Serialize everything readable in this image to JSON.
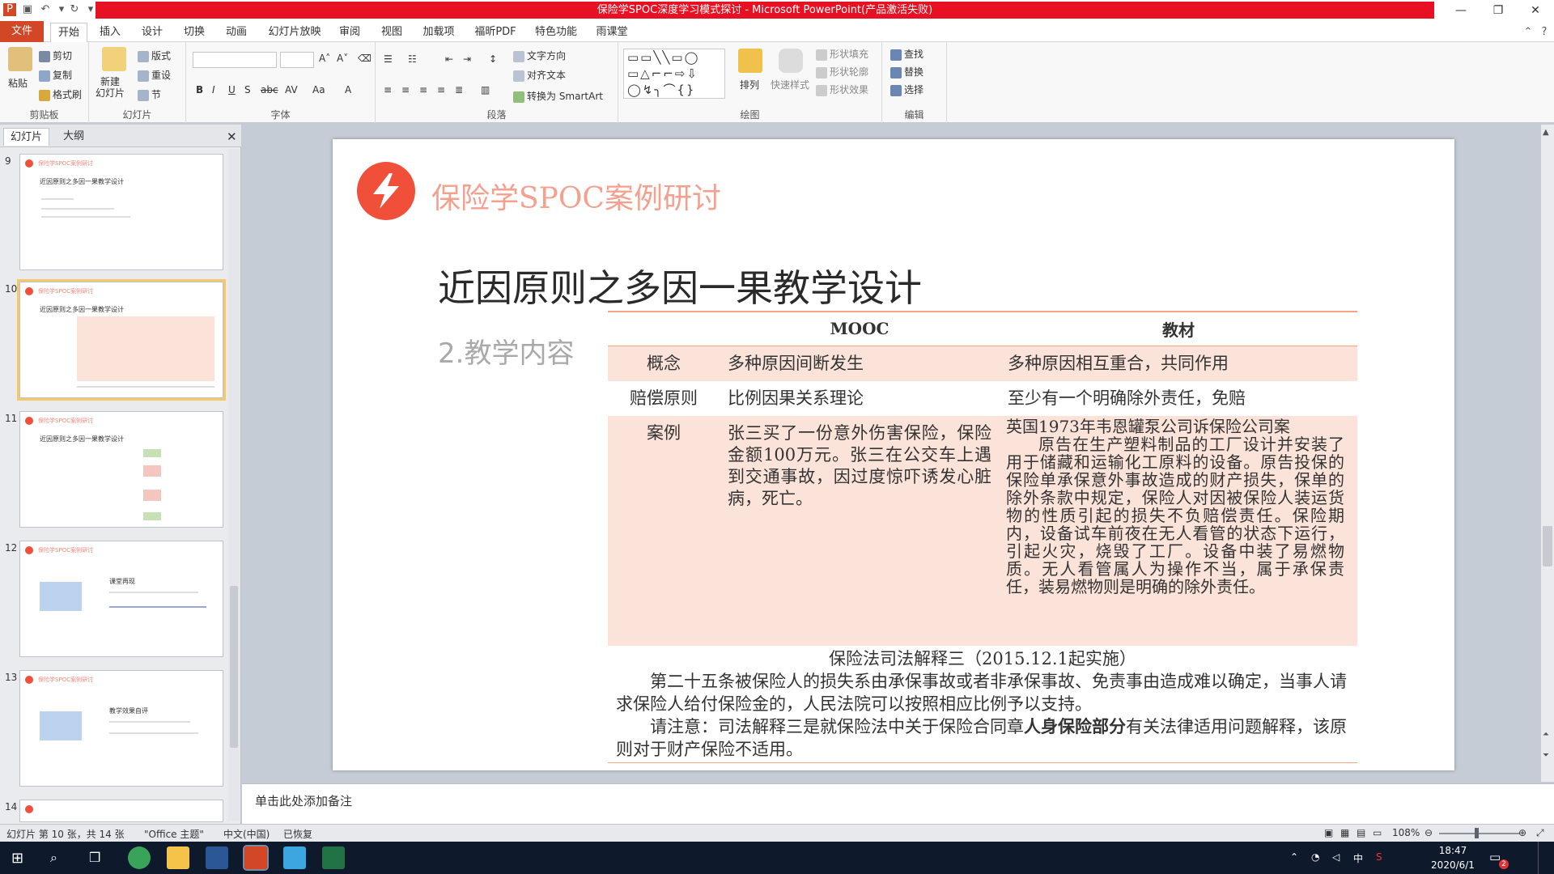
{
  "window": {
    "title": "保险学SPOC深度学习模式探讨 - Microsoft PowerPoint(产品激活失败)"
  },
  "ribbon": {
    "tabs": [
      "文件",
      "开始",
      "插入",
      "设计",
      "切换",
      "动画",
      "幻灯片放映",
      "审阅",
      "视图",
      "加载项",
      "福昕PDF",
      "特色功能",
      "雨课堂"
    ],
    "active_tab": "开始",
    "groups": {
      "clipboard": {
        "label": "剪贴板",
        "paste": "粘贴",
        "cut": "剪切",
        "copy": "复制",
        "format_painter": "格式刷"
      },
      "slides": {
        "label": "幻灯片",
        "new_slide": "新建\n幻灯片",
        "layout": "版式",
        "reset": "重设",
        "section": "节"
      },
      "font": {
        "label": "字体"
      },
      "paragraph": {
        "label": "段落",
        "text_direction": "文字方向",
        "align_text": "对齐文本",
        "convert_smartart": "转换为 SmartArt"
      },
      "drawing": {
        "label": "绘图",
        "arrange": "排列",
        "quick_styles": "快速样式",
        "shape_fill": "形状填充",
        "shape_outline": "形状轮廓",
        "shape_effects": "形状效果"
      },
      "editing": {
        "label": "编辑",
        "find": "查找",
        "replace": "替换",
        "select": "选择"
      }
    }
  },
  "left_panel": {
    "tabs": [
      "幻灯片",
      "大纲"
    ],
    "thumbnails": [
      {
        "num": "9",
        "brand": "保险学SPOC案例研讨",
        "title": "近因原则之多因一果教学设计"
      },
      {
        "num": "10",
        "brand": "保险学SPOC案例研讨",
        "title": "近因原则之多因一果教学设计"
      },
      {
        "num": "11",
        "brand": "保险学SPOC案例研讨",
        "title": "近因原则之多因一果教学设计"
      },
      {
        "num": "12",
        "brand": "保险学SPOC案例研讨",
        "title": "课堂再现"
      },
      {
        "num": "13",
        "brand": "保险学SPOC案例研讨",
        "title": "教学效果自评"
      },
      {
        "num": "14",
        "brand": "",
        "title": ""
      }
    ]
  },
  "slide": {
    "brand": "保险学SPOC案例研讨",
    "title": "近因原则之多因一果教学设计",
    "subtitle": "2.教学内容",
    "table": {
      "headers": [
        "",
        "MOOC",
        "教材"
      ],
      "rows": [
        {
          "cat": "概念",
          "mooc": "多种原因间断发生",
          "book": "多种原因相互重合，共同作用"
        },
        {
          "cat": "赔偿原则",
          "mooc": "比例因果关系理论",
          "book": "至少有一个明确除外责任，免赔"
        },
        {
          "cat": "案例",
          "mooc": "张三买了一份意外伤害保险，保险金额100万元。张三在公交车上遇到交通事故，因过度惊吓诱发心脏病，死亡。",
          "book_line1": "英国1973年韦恩罐泵公司诉保险公司案",
          "book_rest": "原告在生产塑料制品的工厂设计并安装了用于储藏和运输化工原料的设备。原告投保的保险单承保意外事故造成的财产损失，保单的除外条款中规定，保险人对因被保险人装运货物的性质引起的损失不负赔偿责任。保险期内，设备试车前夜在无人看管的状态下运行，引起火灾，烧毁了工厂。设备中装了易燃物质。无人看管属人为操作不当，属于承保责任，装易燃物则是明确的除外责任。"
        }
      ]
    },
    "law": {
      "title": "保险法司法解释三（2015.12.1起实施）",
      "para1": "第二十五条被保险人的损失系由承保事故或者非承保事故、免责事由造成难以确定，当事人请求保险人给付保险金的，人民法院可以按照相应比例予以支持。",
      "para2_pre": "请注意：司法解释三是就保险法中关于保险合同章",
      "para2_bold": "人身保险部分",
      "para2_post": "有关法律适用问题解释，该原则对于财产保险不适用。"
    }
  },
  "notes": {
    "placeholder": "单击此处添加备注"
  },
  "statusbar": {
    "slide_info": "幻灯片 第 10 张，共 14 张",
    "theme": "\"Office 主题\"",
    "language": "中文(中国)",
    "recovered": "已恢复",
    "zoom": "108%"
  },
  "taskbar": {
    "time": "18:47",
    "date": "2020/6/1",
    "ime": "中",
    "notification_count": "2"
  },
  "colors": {
    "accent": "#f0503a",
    "brand_text": "#f4a08f",
    "table_band": "#fbe3d9",
    "title_bar": "#e81123"
  }
}
